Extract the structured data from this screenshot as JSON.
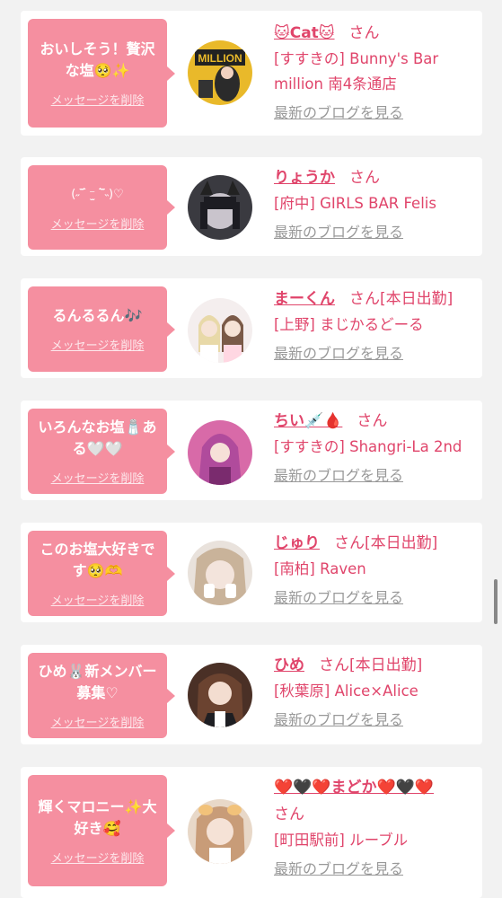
{
  "items": [
    {
      "msg": "おいしそう！贅沢な塩🥺✨",
      "delete": "メッセージを削除",
      "name": "🐱Cat🐱",
      "san": "さん",
      "status": "",
      "shop": "[すすきの] Bunny's Bar million 南4条通店",
      "blog": "最新のブログを見る",
      "avatar": "cat-avatar"
    },
    {
      "msg": "(˶‾᷄ ⁻̫ ‾᷅˵)♡",
      "delete": "メッセージを削除",
      "name": "りょうか",
      "san": "さん",
      "status": "",
      "shop": "[府中] GIRLS BAR Felis",
      "blog": "最新のブログを見る",
      "avatar": "ryoka-avatar"
    },
    {
      "msg": "るんるるん🎶",
      "delete": "メッセージを削除",
      "name": "まーくん",
      "san": "さん[本日出勤]",
      "status": "",
      "shop": "[上野] まじかるどーる",
      "blog": "最新のブログを見る",
      "avatar": "makun-avatar"
    },
    {
      "msg": "いろんなお塩🧂ある🤍🤍",
      "delete": "メッセージを削除",
      "name": "ちい💉🩸",
      "san": "さん",
      "status": "",
      "shop": "[すすきの] Shangri-La 2nd",
      "blog": "最新のブログを見る",
      "avatar": "chii-avatar"
    },
    {
      "msg": "このお塩大好きです🥺🫶",
      "delete": "メッセージを削除",
      "name": "じゅり",
      "san": "さん[本日出勤]",
      "status": "",
      "shop": "[南柏] Raven",
      "blog": "最新のブログを見る",
      "avatar": "juri-avatar"
    },
    {
      "msg": "ひめ🐰新メンバー募集♡",
      "delete": "メッセージを削除",
      "name": "ひめ",
      "san": "さん[本日出勤]",
      "status": "",
      "shop": "[秋葉原] Alice×Alice",
      "blog": "最新のブログを見る",
      "avatar": "hime-avatar"
    },
    {
      "msg": "輝くマロニー✨大好き🥰",
      "delete": "メッセージを削除",
      "name": "❤️🖤❤️まどか❤️🖤❤️",
      "san": "さん",
      "status": "",
      "shop": "[町田駅前] ルーブル",
      "blog": "最新のブログを見る",
      "avatar": "madoka-avatar"
    }
  ],
  "colors": {
    "accent": "#e0456b",
    "bubble": "#f58fa0",
    "background": "#f2f2f2"
  }
}
